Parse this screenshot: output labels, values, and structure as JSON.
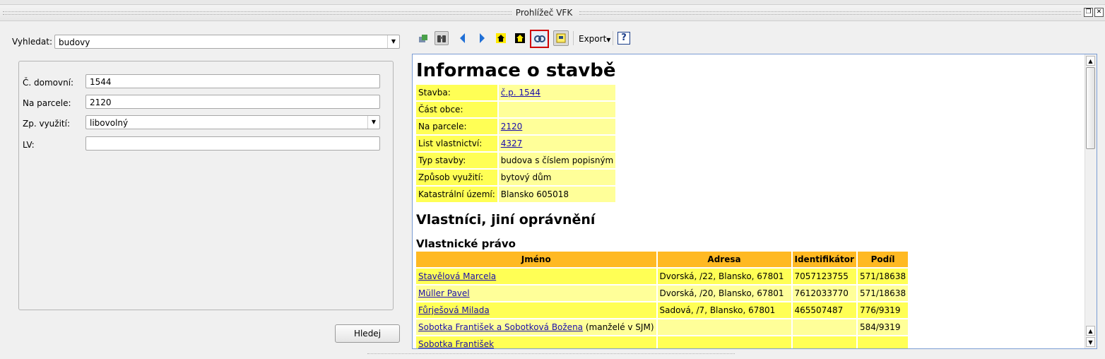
{
  "window": {
    "title": "Prohlížeč VFK"
  },
  "search": {
    "label": "Vyhledat:",
    "value": "budovy",
    "fields": {
      "house_number": {
        "label": "Č. domovní:",
        "value": "1544"
      },
      "parcel": {
        "label": "Na parcele:",
        "value": "2120"
      },
      "usage": {
        "label": "Zp. využití:",
        "value": "libovolný"
      },
      "lv": {
        "label": "LV:",
        "value": ""
      }
    },
    "submit_label": "Hledej"
  },
  "toolbar": {
    "icons": [
      "export-to-qgis-icon",
      "binoculars-icon",
      "back-icon",
      "forward-icon",
      "home-icon",
      "home-alt-icon",
      "link-icon",
      "notes-icon",
      "help-icon"
    ],
    "export_label": "Export",
    "help_label": "?"
  },
  "info": {
    "title": "Informace o stavbě",
    "rows": [
      {
        "key": "Stavba:",
        "value": "č.p. 1544",
        "link": true
      },
      {
        "key": "Část obce:",
        "value": "",
        "link": false
      },
      {
        "key": "Na parcele:",
        "value": "2120",
        "link": true
      },
      {
        "key": "List vlastnictví:",
        "value": "4327",
        "link": true
      },
      {
        "key": "Typ stavby:",
        "value": "budova s číslem popisným",
        "link": false
      },
      {
        "key": "Způsob využití:",
        "value": "bytový dům",
        "link": false
      },
      {
        "key": "Katastrální území:",
        "value": "Blansko 605018",
        "link": false
      }
    ],
    "owners_heading": "Vlastníci, jiní oprávnění",
    "ownership_heading": "Vlastnické právo",
    "owner_columns": [
      "Jméno",
      "Adresa",
      "Identifikátor",
      "Podíl"
    ],
    "owners": [
      {
        "name": "Stavělová Marcela ",
        "note": "",
        "address": "Dvorská, /22, Blansko, 67801",
        "id": "7057123755",
        "share": "571/18638"
      },
      {
        "name": "Müller Pavel ",
        "note": "",
        "address": "Dvorská, /20, Blansko, 67801",
        "id": "7612033770",
        "share": "571/18638"
      },
      {
        "name": "Fůrješová Milada ",
        "note": "",
        "address": "Sadová, /7, Blansko, 67801",
        "id": "465507487",
        "share": "776/9319"
      },
      {
        "name": "Sobotka František a Sobotková Božena",
        "note": " (manželé v SJM)",
        "address": "",
        "id": "",
        "share": "584/9319"
      },
      {
        "name": "Sobotka František",
        "note": "",
        "address": "",
        "id": "",
        "share": ""
      }
    ]
  },
  "colors": {
    "key_cell": "#ffff55",
    "value_cell": "#ffff99",
    "header_cell": "#ffb922",
    "highlight": "#d00000"
  }
}
